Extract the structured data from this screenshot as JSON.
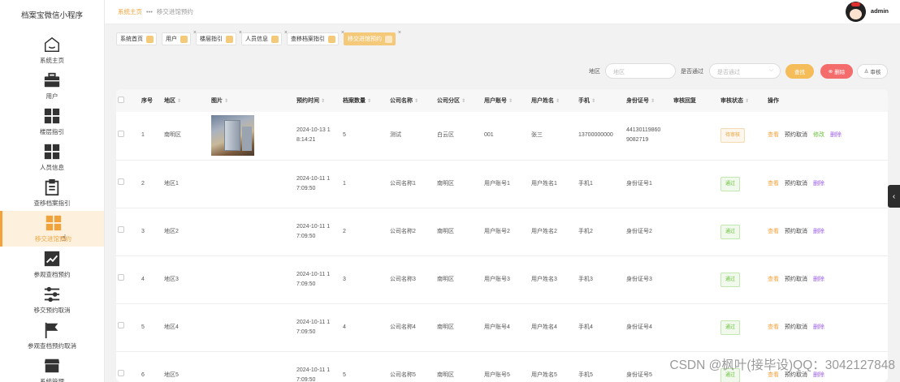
{
  "app_title": "档案宝微信小程序",
  "sidebar": {
    "items": [
      {
        "label": "系统主页",
        "icon": "home-icon"
      },
      {
        "label": "用户",
        "icon": "briefcase-icon"
      },
      {
        "label": "楼层指引",
        "icon": "grid-icon"
      },
      {
        "label": "人员信息",
        "icon": "grid-icon"
      },
      {
        "label": "查移档案指引",
        "icon": "clipboard-icon"
      },
      {
        "label": "移交进馆预约",
        "icon": "grid-icon"
      },
      {
        "label": "参观查档预约",
        "icon": "chart-icon"
      },
      {
        "label": "移交预约取消",
        "icon": "sliders-icon"
      },
      {
        "label": "参观查档预约取消",
        "icon": "flag-icon"
      },
      {
        "label": "系统管理",
        "icon": "store-icon"
      }
    ],
    "active_index": 5
  },
  "header": {
    "breadcrumb_home": "系统主页",
    "breadcrumb_sep": "•••",
    "breadcrumb_current": "移交进馆预约",
    "username": "admin"
  },
  "tabs": [
    {
      "label": "系统首页"
    },
    {
      "label": "用户"
    },
    {
      "label": "楼层指引"
    },
    {
      "label": "人员信息"
    },
    {
      "label": "查移档案指引"
    },
    {
      "label": "移交进馆预约"
    }
  ],
  "search": {
    "region_label": "地区",
    "region_placeholder": "地区",
    "approved_label": "是否通过",
    "approved_placeholder": "是否通过",
    "search_button": "查找",
    "delete_button": "删除",
    "review_button": "审核",
    "colors": {
      "search": "#f5bd5a",
      "delete": "#f56c6c"
    }
  },
  "table": {
    "headers": [
      "序号",
      "地区",
      "图片",
      "预约时间",
      "档案数量",
      "公司名称",
      "公司分区",
      "用户账号",
      "用户姓名",
      "手机",
      "身份证号",
      "审核回复",
      "审核状态",
      "操作"
    ],
    "rows": [
      {
        "no": "1",
        "region": "南明区",
        "image": true,
        "time": "2024-10-13 1\n8:14:21",
        "count": "5",
        "company": "测试",
        "district": "白云区",
        "account": "001",
        "name": "张三",
        "phone": "13700000000",
        "idno": "44130119860\n9082719",
        "reply": "",
        "status": "待审核",
        "status_type": "pending",
        "ops": [
          "查看",
          "预约取消",
          "修改",
          "删除"
        ]
      },
      {
        "no": "2",
        "region": "地区1",
        "image": false,
        "time": "2024-10-11 1\n7:09:50",
        "count": "1",
        "company": "公司名称1",
        "district": "南明区",
        "account": "用户账号1",
        "name": "用户姓名1",
        "phone": "手机1",
        "idno": "身份证号1",
        "reply": "",
        "status": "通过",
        "status_type": "pass",
        "ops": [
          "查看",
          "预约取消",
          "删除"
        ]
      },
      {
        "no": "3",
        "region": "地区2",
        "image": false,
        "time": "2024-10-11 1\n7:09:50",
        "count": "2",
        "company": "公司名称2",
        "district": "南明区",
        "account": "用户账号2",
        "name": "用户姓名2",
        "phone": "手机2",
        "idno": "身份证号2",
        "reply": "",
        "status": "通过",
        "status_type": "pass",
        "ops": [
          "查看",
          "预约取消",
          "删除"
        ]
      },
      {
        "no": "4",
        "region": "地区3",
        "image": false,
        "time": "2024-10-11 1\n7:09:50",
        "count": "3",
        "company": "公司名称3",
        "district": "南明区",
        "account": "用户账号3",
        "name": "用户姓名3",
        "phone": "手机3",
        "idno": "身份证号3",
        "reply": "",
        "status": "通过",
        "status_type": "pass",
        "ops": [
          "查看",
          "预约取消",
          "删除"
        ]
      },
      {
        "no": "5",
        "region": "地区4",
        "image": false,
        "time": "2024-10-11 1\n7:09:50",
        "count": "4",
        "company": "公司名称4",
        "district": "南明区",
        "account": "用户账号4",
        "name": "用户姓名4",
        "phone": "手机4",
        "idno": "身份证号4",
        "reply": "",
        "status": "通过",
        "status_type": "pass",
        "ops": [
          "查看",
          "预约取消",
          "删除"
        ]
      },
      {
        "no": "6",
        "region": "地区5",
        "image": false,
        "time": "2024-10-11 1\n7:09:50",
        "count": "5",
        "company": "公司名称5",
        "district": "南明区",
        "account": "用户账号5",
        "name": "用户姓名5",
        "phone": "手机5",
        "idno": "身份证号5",
        "reply": "",
        "status": "通过",
        "status_type": "pass",
        "ops": [
          "查看",
          "预约取消",
          "删除"
        ]
      }
    ]
  },
  "watermark": "CSDN @枫叶(接毕设)QQ：3042127848",
  "accent_color": "#f2a23a"
}
